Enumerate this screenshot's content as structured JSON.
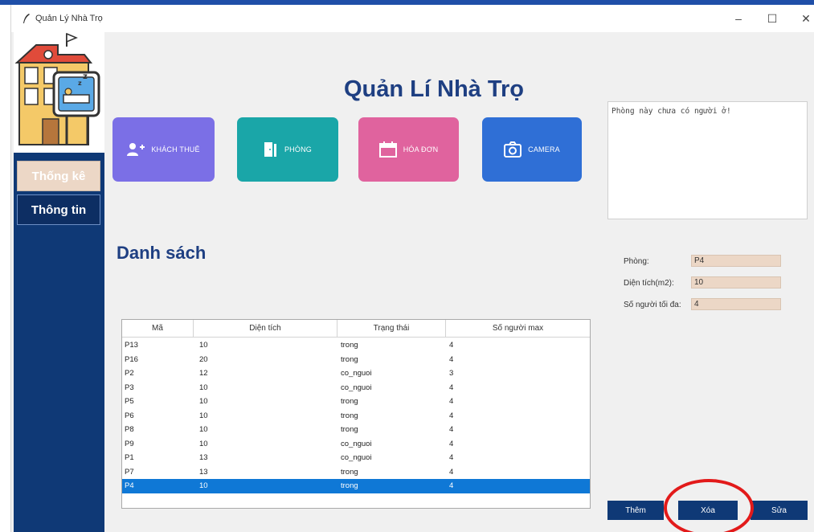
{
  "window": {
    "title": "Quản Lý Nhà Trọ",
    "minimize_glyph": "–",
    "maximize_glyph": "☐",
    "close_glyph": "✕"
  },
  "sidebar": {
    "items": [
      {
        "label": "Thống kê"
      },
      {
        "label": "Thông tin"
      }
    ]
  },
  "header": {
    "title": "Quản Lí Nhà Trọ"
  },
  "tiles": [
    {
      "label": "KHÁCH THUÊ",
      "icon": "add-user-icon"
    },
    {
      "label": "PHÒNG",
      "icon": "door-icon"
    },
    {
      "label": "HÓA ĐƠN",
      "icon": "calendar-icon"
    },
    {
      "label": "CAMERA",
      "icon": "camera-icon"
    }
  ],
  "section": {
    "title": "Danh sách"
  },
  "table": {
    "columns": [
      "Mã",
      "Diện tích",
      "Trạng thái",
      "Số người max"
    ],
    "rows": [
      [
        "P13",
        "10",
        "trong",
        "4"
      ],
      [
        "P16",
        "20",
        "trong",
        "4"
      ],
      [
        "P2",
        "12",
        "co_nguoi",
        "3"
      ],
      [
        "P3",
        "10",
        "co_nguoi",
        "4"
      ],
      [
        "P5",
        "10",
        "trong",
        "4"
      ],
      [
        "P6",
        "10",
        "trong",
        "4"
      ],
      [
        "P8",
        "10",
        "trong",
        "4"
      ],
      [
        "P9",
        "10",
        "co_nguoi",
        "4"
      ],
      [
        "P1",
        "13",
        "co_nguoi",
        "4"
      ],
      [
        "P7",
        "13",
        "trong",
        "4"
      ],
      [
        "P4",
        "10",
        "trong",
        "4"
      ]
    ],
    "selected_row": 10
  },
  "detail": {
    "note": "Phòng này chưa có người ở!",
    "fields": [
      {
        "label": "Phòng:",
        "value": "P4"
      },
      {
        "label": "Diện tích(m2):",
        "value": "10"
      },
      {
        "label": "Số người tối đa:",
        "value": "4"
      }
    ],
    "buttons": {
      "add": "Thêm",
      "delete": "Xóa",
      "edit": "Sửa"
    }
  },
  "colors": {
    "sidebar": "#0f3976",
    "title": "#1e3f82",
    "tile_khach_thue": "#7b6fe6",
    "tile_phong": "#1aa6a8",
    "tile_hoa_don": "#e0639e",
    "tile_camera": "#2f6fd6",
    "selection": "#0f78d6",
    "annotation": "#e21a1a"
  }
}
